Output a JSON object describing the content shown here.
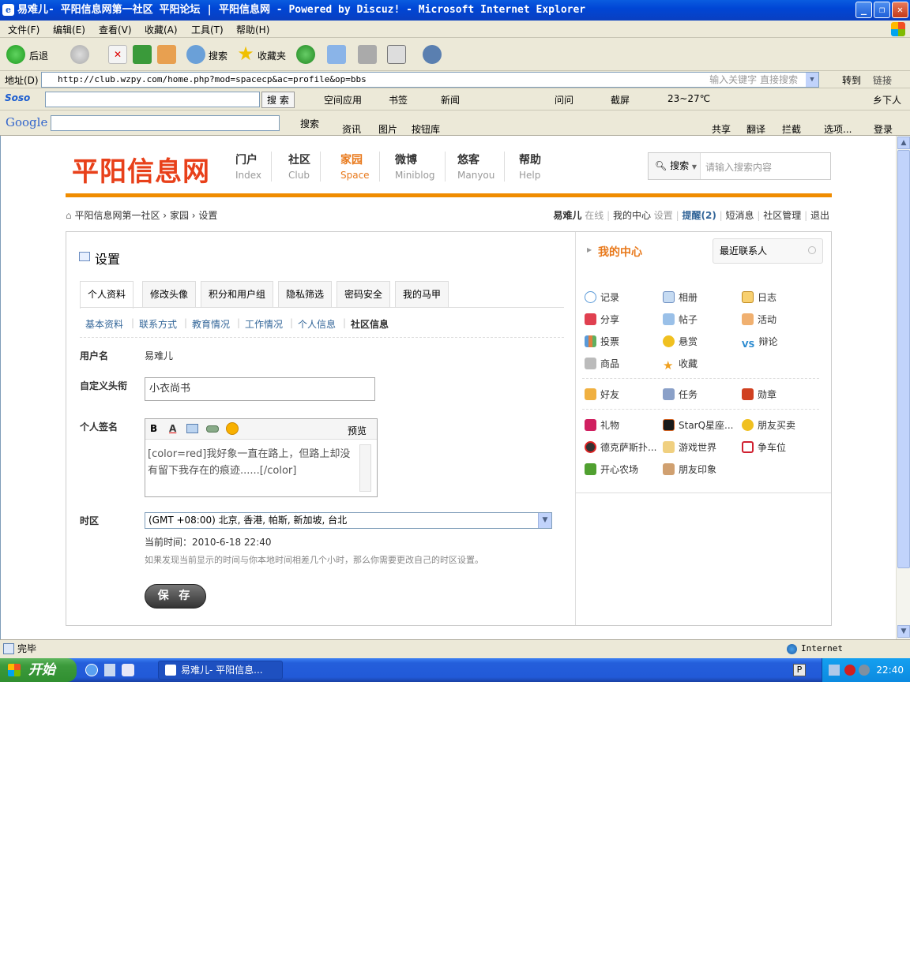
{
  "window": {
    "title": "易难儿- 平阳信息网第一社区 平阳论坛 | 平阳信息网 - Powered by Discuz! - Microsoft Internet Explorer",
    "ie_glyph": "e"
  },
  "menu": [
    "文件(F)",
    "编辑(E)",
    "查看(V)",
    "收藏(A)",
    "工具(T)",
    "帮助(H)"
  ],
  "toolbar": {
    "back": "后退",
    "search": "搜索",
    "favorites": "收藏夹"
  },
  "address": {
    "label": "地址(D)",
    "url": "http://club.wzpy.com/home.php?mod=spacecp&ac=profile&op=bbs",
    "keyword_placeholder": "输入关键字 直接搜索",
    "go": "转到",
    "links": "链接"
  },
  "soso": {
    "brand": "Soso",
    "search_btn": "搜 索",
    "items": [
      "空间应用",
      "书签",
      "新闻",
      "问问",
      "截屏",
      "23~27℃",
      "乡下人"
    ]
  },
  "google": {
    "brand": "Google",
    "search": "搜索",
    "items": [
      "资讯",
      "图片",
      "按钮库",
      "共享",
      "翻译",
      "拦截",
      "选项...",
      "登录"
    ]
  },
  "site": {
    "logo": "平阳信息网",
    "nav": [
      {
        "cn": "门户",
        "en": "Index"
      },
      {
        "cn": "社区",
        "en": "Club"
      },
      {
        "cn": "家园",
        "en": "Space"
      },
      {
        "cn": "微博",
        "en": "Miniblog"
      },
      {
        "cn": "悠客",
        "en": "Manyou"
      },
      {
        "cn": "帮助",
        "en": "Help"
      }
    ],
    "search_btn": "搜索",
    "search_placeholder": "请输入搜索内容"
  },
  "breadcrumb": {
    "home": "平阳信息网第一社区",
    "sep": "›",
    "space": "家园",
    "settings": "设置"
  },
  "userbar": {
    "username": "易难儿",
    "status": "在线",
    "center": "我的中心",
    "set": "设置",
    "remind": "提醒(2)",
    "sms": "短消息",
    "admin": "社区管理",
    "logout": "退出"
  },
  "settings": {
    "title": "设置",
    "tabs": [
      "个人资料",
      "修改头像",
      "积分和用户组",
      "隐私筛选",
      "密码安全",
      "我的马甲"
    ],
    "subtabs": [
      "基本资料",
      "联系方式",
      "教育情况",
      "工作情况",
      "个人信息",
      "社区信息"
    ],
    "username_label": "用户名",
    "username": "易难儿",
    "customtitle_label": "自定义头衔",
    "customtitle": "小衣尚书",
    "signature_label": "个人签名",
    "preview": "预览",
    "editor_bold": "B",
    "editor_color": "A",
    "signature": "[color=red]我好象一直在路上，但路上却没有留下我存在的痕迹......[/color]",
    "tz_label": "时区",
    "tz_value": "(GMT +08:00) 北京, 香港, 帕斯, 新加坡, 台北",
    "current_time": "当前时间：2010-6-18 22:40",
    "tz_note": "如果发现当前显示的时间与你本地时间相差几个小时，那么你需要更改自己的时区设置。",
    "save": "保 存"
  },
  "sidebar": {
    "title": "我的中心",
    "recent": "最近联系人",
    "items": [
      "记录",
      "相册",
      "日志",
      "分享",
      "帖子",
      "活动",
      "投票",
      "悬赏",
      "辩论",
      "商品",
      "收藏"
    ],
    "items2": [
      "好友",
      "任务",
      "勋章"
    ],
    "apps": [
      "礼物",
      "StarQ星座...",
      "朋友买卖",
      "德克萨斯扑...",
      "游戏世界",
      "争车位",
      "开心农场",
      "朋友印象"
    ]
  },
  "status": {
    "text": "完毕",
    "zone": "Internet"
  },
  "taskbar": {
    "start": "开始",
    "app": "易难儿- 平阳信息...",
    "time": "22:40"
  },
  "colors": {
    "accent": "#e8781a",
    "logo": "#e8401a",
    "link": "#336699"
  }
}
